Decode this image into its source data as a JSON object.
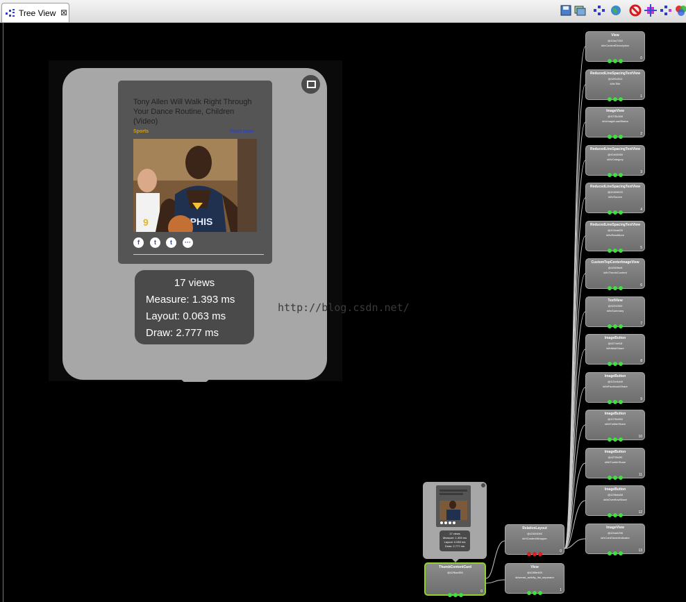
{
  "tab": {
    "label": "Tree View",
    "close": "⊠"
  },
  "toolbar_icons": [
    "save-icon",
    "load-overlay-icon",
    "tree-icon",
    "globe-icon",
    "stop-icon",
    "request-layout-icon",
    "tree-dump-icon",
    "color-icon"
  ],
  "popup": {
    "card_title": "Tony Allen Will Walk Right Through Your Dance Routine, Children (Video)",
    "category": "Sports",
    "read_more": "Read more",
    "social": [
      "f",
      "t",
      "t",
      "···"
    ],
    "stats": {
      "views": "17 views",
      "measure": "Measure: 1.393 ms",
      "layout": "Layout: 0.063 ms",
      "draw": "Draw: 2.777 ms"
    }
  },
  "watermark": "http://blog.csdn.net/",
  "children": [
    {
      "name": "View",
      "addr": "@42ac7150",
      "rid": "id/vContentDescription",
      "index": "0"
    },
    {
      "name": "ReducedLineSpacingTextView",
      "addr": "@42f0d310",
      "rid": "id/tvTitle",
      "index": "1"
    },
    {
      "name": "ImageView",
      "addr": "@4278c368",
      "rid": "id/vImageLoadStatus",
      "index": "2"
    },
    {
      "name": "ReducedLineSpacingTextView",
      "addr": "@42d44060",
      "rid": "id/tvCategory",
      "index": "3"
    },
    {
      "name": "ReducedLineSpacingTextView",
      "addr": "@42d2d620",
      "rid": "id/tvSource",
      "index": "4"
    },
    {
      "name": "ReducedLineSpacingTextView",
      "addr": "@424cad28",
      "rid": "id/tvReadMore",
      "index": "5"
    },
    {
      "name": "CustomTopCenterImageView",
      "addr": "@4256fbe8",
      "rid": "id/ivThumbContent",
      "index": "6"
    },
    {
      "name": "TextView",
      "addr": "@4231f300",
      "rid": "id/tvSummary",
      "index": "7"
    },
    {
      "name": "ImageButton",
      "addr": "@4274ef18",
      "rid": "id/btMailShare",
      "index": "8"
    },
    {
      "name": "ImageButton",
      "addr": "@421e4cb8",
      "rid": "id/btFacebookShare",
      "index": "9"
    },
    {
      "name": "ImageButton",
      "addr": "@4276c060",
      "rid": "id/btTwitterShare",
      "index": "10"
    },
    {
      "name": "ImageButton",
      "addr": "@4276b2f0",
      "rid": "id/btTumblrShare",
      "index": "11"
    },
    {
      "name": "ImageButton",
      "addr": "@4296da68",
      "rid": "id/btOverflowShare",
      "index": "12"
    },
    {
      "name": "ImageView",
      "addr": "@42ea0298",
      "rid": "id/vCardSavedIndicator",
      "index": "13"
    }
  ],
  "relative_layout": {
    "name": "RelativeLayout",
    "addr": "@42604060",
    "rid": "id/rlContentWrapper",
    "index": "0"
  },
  "separator": {
    "name": "View",
    "addr": "@4285e460",
    "rid": "id/wread_activity_list_separator",
    "index": "1"
  },
  "thumb_card": {
    "name": "ThumbContentCard",
    "addr": "@42f6ac850",
    "rid": "",
    "index": "0"
  },
  "mini": {
    "views": "17 views",
    "measure": "Measure: 1.393 ms",
    "layout": "Layout: 0.063 ms",
    "draw": "Draw: 2.777 ms"
  },
  "colors": {
    "dot_green": "#3fe03f",
    "dot_red": "#e02020",
    "selected_border": "#8fd22c"
  }
}
